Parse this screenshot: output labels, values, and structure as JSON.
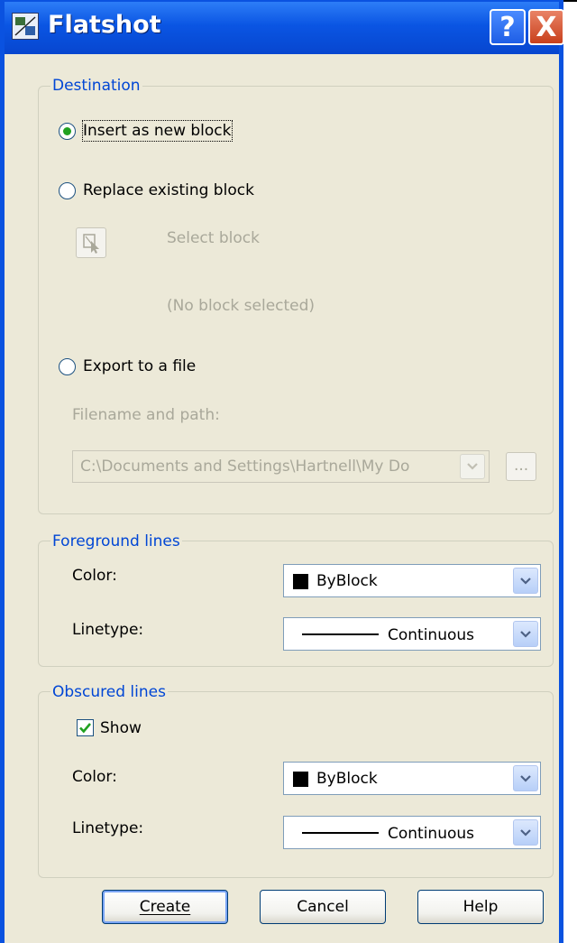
{
  "window": {
    "title": "Flatshot",
    "help_button": "?",
    "close_button": "X"
  },
  "destination": {
    "legend": "Destination",
    "insert_label": "Insert as new block",
    "replace_label": "Replace existing block",
    "select_block_label": "Select block",
    "no_block_label": "(No block selected)",
    "export_label": "Export to a file",
    "filename_label": "Filename and path:",
    "filename_value": "C:\\Documents and Settings\\Hartnell\\My Do",
    "browse_label": "...",
    "selected": "insert"
  },
  "foreground": {
    "legend": "Foreground lines",
    "color_label": "Color:",
    "color_value": "ByBlock",
    "linetype_label": "Linetype:",
    "linetype_value": "Continuous"
  },
  "obscured": {
    "legend": "Obscured lines",
    "show_label": "Show",
    "show_checked": true,
    "color_label": "Color:",
    "color_value": "ByBlock",
    "linetype_label": "Linetype:",
    "linetype_value": "Continuous"
  },
  "buttons": {
    "create": "Create",
    "cancel": "Cancel",
    "help": "Help"
  },
  "colors": {
    "title_bar": "#0a55e3",
    "dialog_bg": "#ece9d8",
    "legend_text": "#0046d5",
    "radio_dot": "#21a121"
  },
  "icons": {
    "app": "flatshot-icon",
    "select_block": "select-object-icon",
    "dropdown": "chevron-down-icon",
    "checkbox": "checkmark-icon"
  }
}
